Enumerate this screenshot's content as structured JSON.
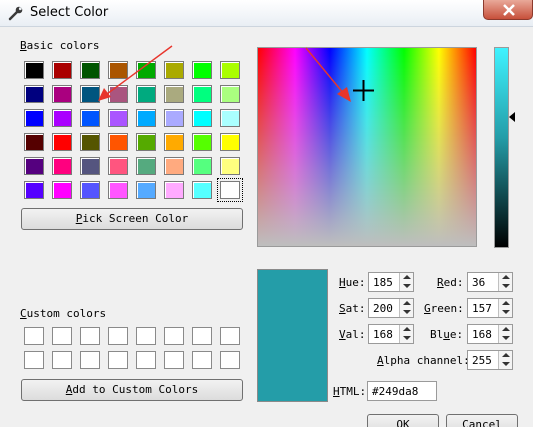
{
  "window": {
    "title": "Select Color",
    "icon": "wrench-icon"
  },
  "basic_colors": {
    "label": "Basic colors",
    "swatches": [
      [
        "#000000",
        "#aa0000",
        "#005500",
        "#aa5500",
        "#00aa00",
        "#aaaa00",
        "#00ff00",
        "#aaff00"
      ],
      [
        "#00007f",
        "#aa007f",
        "#00557f",
        "#aa557f",
        "#00aa7f",
        "#aaaa7f",
        "#00ff7f",
        "#aaff7f"
      ],
      [
        "#0000ff",
        "#aa00ff",
        "#0055ff",
        "#aa55ff",
        "#00aaff",
        "#aaaaff",
        "#00ffff",
        "#aaffff"
      ],
      [
        "#550000",
        "#ff0000",
        "#555500",
        "#ff5500",
        "#55aa00",
        "#ffaa00",
        "#55ff00",
        "#ffff00"
      ],
      [
        "#55007f",
        "#ff007f",
        "#55557f",
        "#ff557f",
        "#55aa7f",
        "#ffaa7f",
        "#55ff7f",
        "#ffff7f"
      ],
      [
        "#5500ff",
        "#ff00ff",
        "#5555ff",
        "#ff55ff",
        "#55aaff",
        "#ffaaff",
        "#55ffff",
        "#ffffff"
      ]
    ]
  },
  "pick_screen_label": "Pick Screen Color",
  "custom_colors": {
    "label": "Custom colors",
    "add_label": "Add to Custom Colors"
  },
  "fields": {
    "hue_label": "Hue:",
    "hue": "185",
    "sat_label": "Sat:",
    "sat": "200",
    "val_label": "Val:",
    "val": "168",
    "red_label": "Red:",
    "red": "36",
    "green_label": "Green:",
    "green": "157",
    "blue_label": "Blue:",
    "blue": "168",
    "alpha_label": "Alpha channel:",
    "alpha": "255",
    "html_label": "HTML:",
    "html": "#249da8"
  },
  "buttons": {
    "ok": "OK",
    "cancel": "Cancel"
  },
  "colors": {
    "current": "#249da8",
    "annotation_arrow": "#e8352c"
  }
}
